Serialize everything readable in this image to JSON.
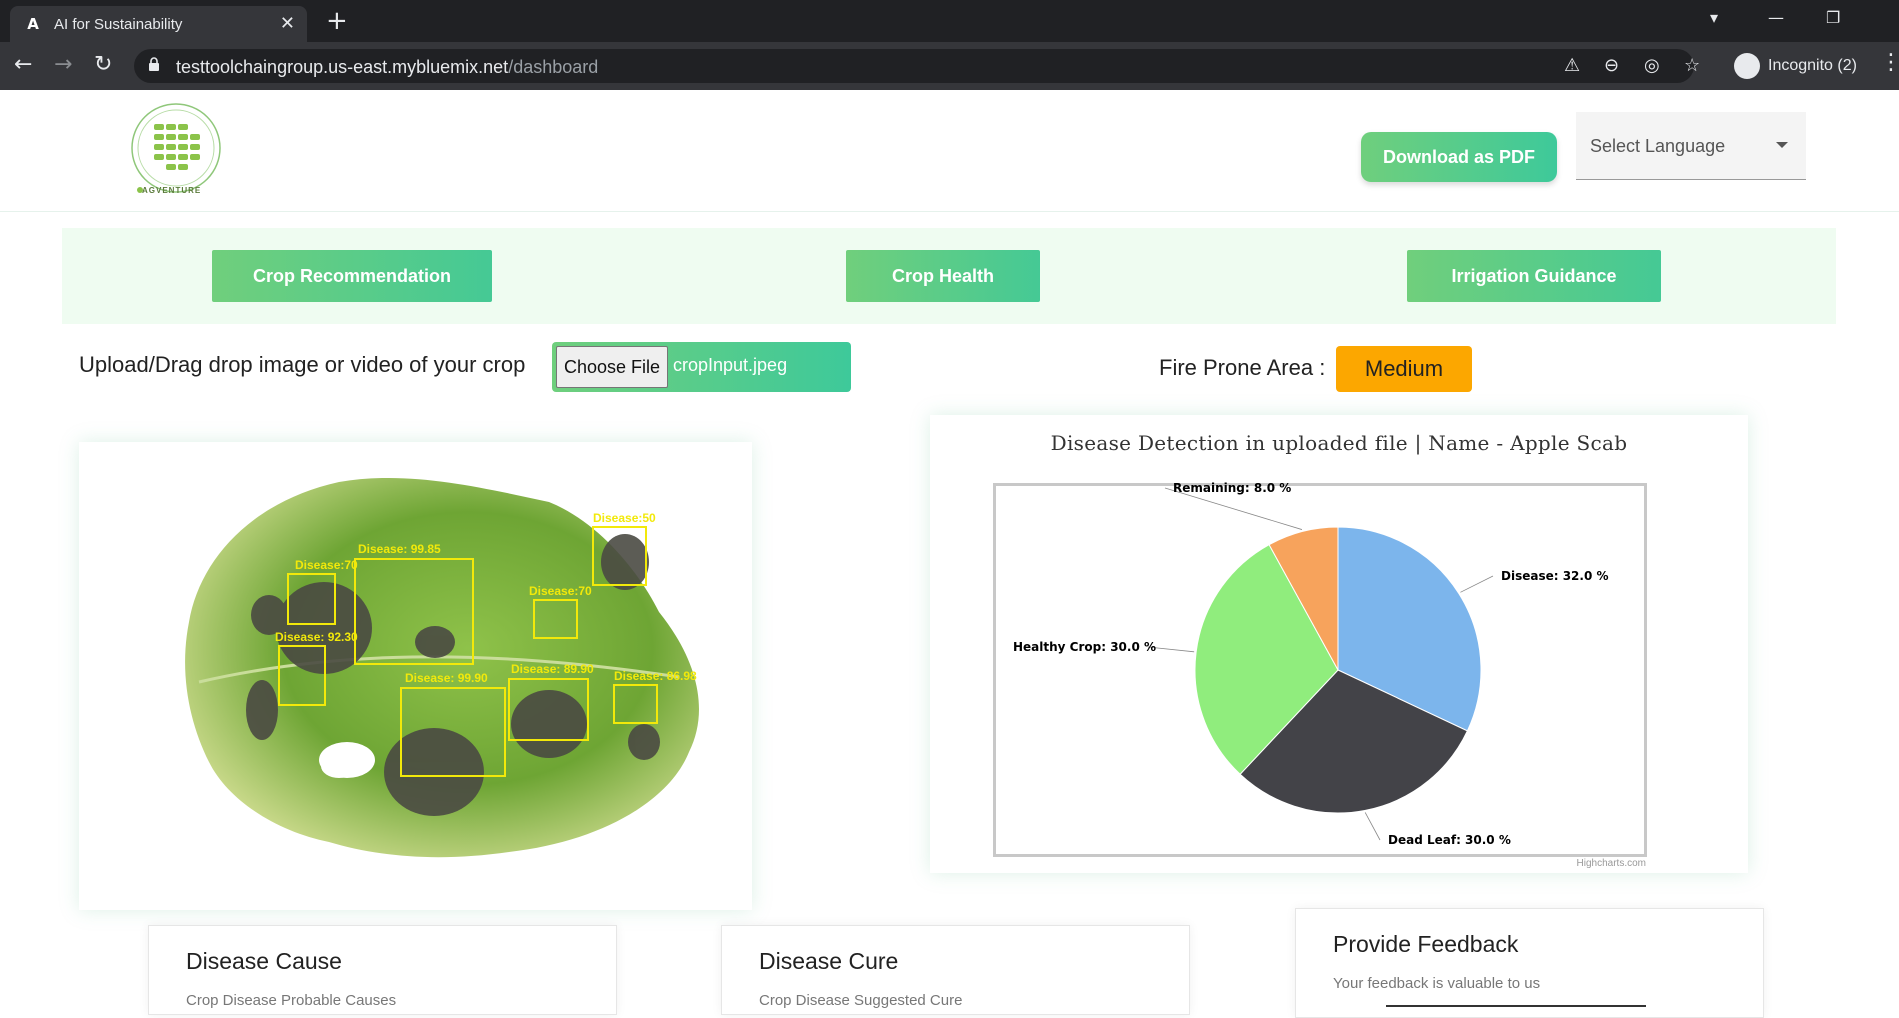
{
  "browser": {
    "tab_title": "AI for Sustainability",
    "tab_favicon": "A",
    "url_host": "testtoolchaingroup.us-east.mybluemix.net",
    "url_path": "/dashboard",
    "incognito_label": "Incognito (2)"
  },
  "header": {
    "logo_text": "AGVENTURE",
    "download_label": "Download as PDF",
    "language_placeholder": "Select Language"
  },
  "nav": {
    "crop_recommendation": "Crop Recommendation",
    "crop_health": "Crop Health",
    "irrigation_guidance": "Irrigation Guidance"
  },
  "upload": {
    "label": "Upload/Drag drop image or video of your crop",
    "button_label": "Choose File",
    "file_name": "cropInput.jpeg"
  },
  "fire": {
    "label": "Fire Prone Area :",
    "value": "Medium",
    "color": "#fca700"
  },
  "detections": [
    {
      "label": "Disease:50"
    },
    {
      "label": "Disease: 99.85"
    },
    {
      "label": "Disease:70"
    },
    {
      "label": "Disease:70"
    },
    {
      "label": "Disease: 92.30"
    },
    {
      "label": "Disease: 89.90"
    },
    {
      "label": "Disease: 99.90"
    },
    {
      "label": "Disease: 86.98"
    }
  ],
  "chart_data": {
    "type": "pie",
    "title": "Disease Detection in uploaded file | Name - Apple Scab",
    "credit": "Highcharts.com",
    "slices": [
      {
        "name": "Disease",
        "value": 32.0,
        "label": "Disease: 32.0 %",
        "color": "#7cb5ec"
      },
      {
        "name": "Dead Leaf",
        "value": 30.0,
        "label": "Dead Leaf: 30.0 %",
        "color": "#434348"
      },
      {
        "name": "Healthy Crop",
        "value": 30.0,
        "label": "Healthy Crop: 30.0 %",
        "color": "#90ed7d"
      },
      {
        "name": "Remaining",
        "value": 8.0,
        "label": "Remaining: 8.0 %",
        "color": "#f7a35c"
      }
    ]
  },
  "cards": {
    "cause_title": "Disease Cause",
    "cause_sub": "Crop Disease Probable Causes",
    "cure_title": "Disease Cure",
    "cure_sub": "Crop Disease Suggested Cure",
    "feedback_title": "Provide Feedback",
    "feedback_sub": "Your feedback is valuable to us"
  }
}
